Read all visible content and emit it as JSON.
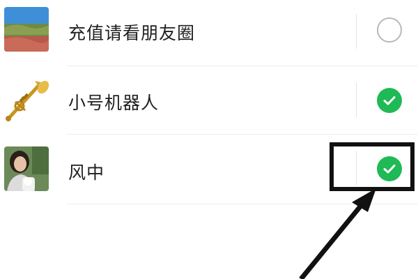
{
  "contacts": [
    {
      "name": "充值请看朋友圈",
      "selected": false,
      "avatar": "landscape-photo"
    },
    {
      "name": "小号机器人",
      "selected": true,
      "avatar": "trumpet-image"
    },
    {
      "name": "风中",
      "selected": true,
      "avatar": "person-photo"
    }
  ],
  "colors": {
    "check_green": "#1fb955",
    "annotation": "#111111"
  }
}
